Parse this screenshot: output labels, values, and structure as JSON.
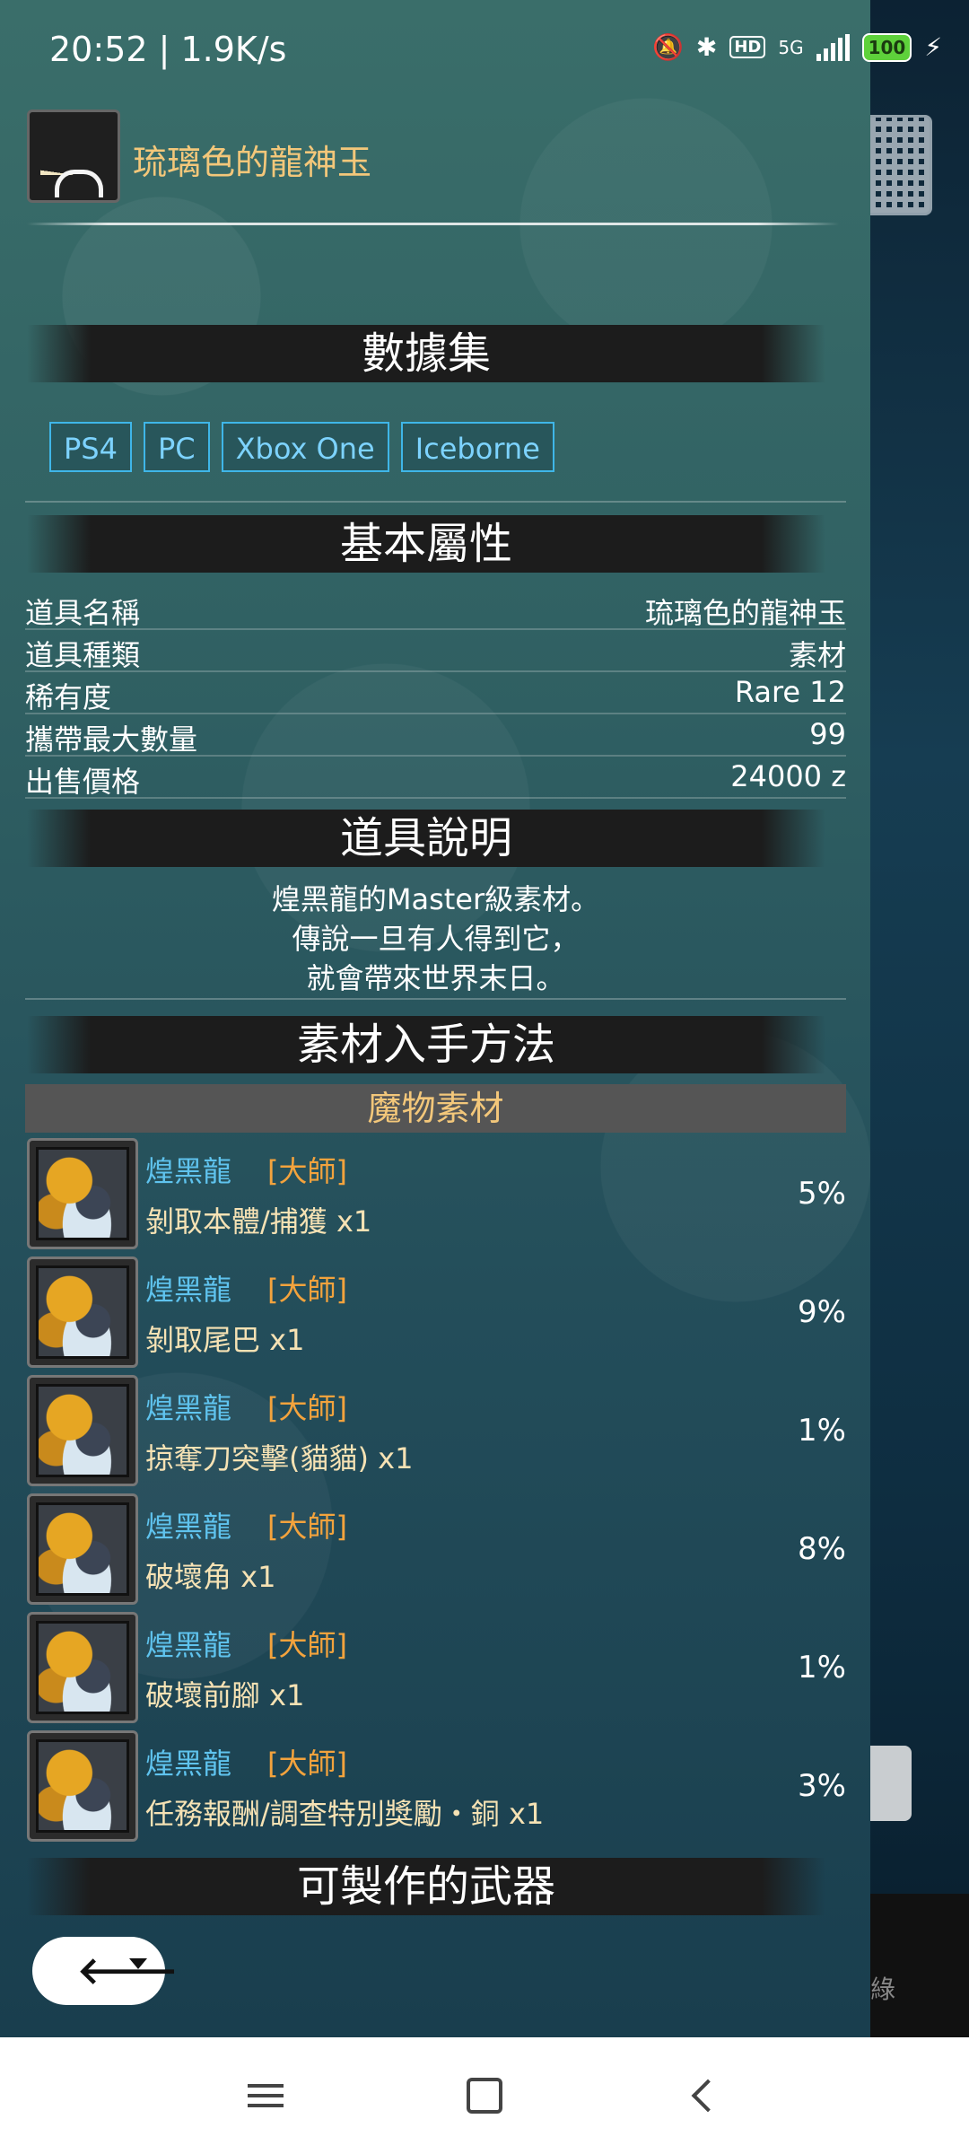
{
  "status_bar": {
    "time_speed": "20:52 | 1.9K/s",
    "hd": "HD",
    "network": "5G",
    "battery": "100"
  },
  "item": {
    "title": "琉璃色的龍神玉",
    "icon": "dragon-gem-icon"
  },
  "sections": {
    "dataset": "數據集",
    "basic": "基本屬性",
    "description": "道具說明",
    "sources": "素材入手方法",
    "weapons": "可製作的武器"
  },
  "platforms": [
    "PS4",
    "PC",
    "Xbox One",
    "Iceborne"
  ],
  "attributes": [
    {
      "key": "道具名稱",
      "value": "琉璃色的龍神玉"
    },
    {
      "key": "道具種類",
      "value": "素材"
    },
    {
      "key": "稀有度",
      "value": "Rare 12"
    },
    {
      "key": "攜帶最大數量",
      "value": "99"
    },
    {
      "key": "出售價格",
      "value": "24000 z"
    }
  ],
  "description": [
    "煌黑龍的Master級素材。",
    "傳說一旦有人得到它，",
    "就會帶來世界末日。"
  ],
  "monster_subheader": "魔物素材",
  "sources": [
    {
      "monster": "煌黑龍",
      "rank": "[大師]",
      "method": "剝取本體/捕獲 x1",
      "rate": "5%"
    },
    {
      "monster": "煌黑龍",
      "rank": "[大師]",
      "method": "剝取尾巴 x1",
      "rate": "9%"
    },
    {
      "monster": "煌黑龍",
      "rank": "[大師]",
      "method": "掠奪刀突擊(貓貓) x1",
      "rate": "1%"
    },
    {
      "monster": "煌黑龍",
      "rank": "[大師]",
      "method": "破壞角 x1",
      "rate": "8%"
    },
    {
      "monster": "煌黑龍",
      "rank": "[大師]",
      "method": "破壞前腳 x1",
      "rate": "1%"
    },
    {
      "monster": "煌黑龍",
      "rank": "[大師]",
      "method": "任務報酬/調查特別獎勵・銅 x1",
      "rate": "3%"
    }
  ],
  "background_app": {
    "partial_text": "綠"
  },
  "back_button": {
    "icon": "back-arrow-icon"
  }
}
